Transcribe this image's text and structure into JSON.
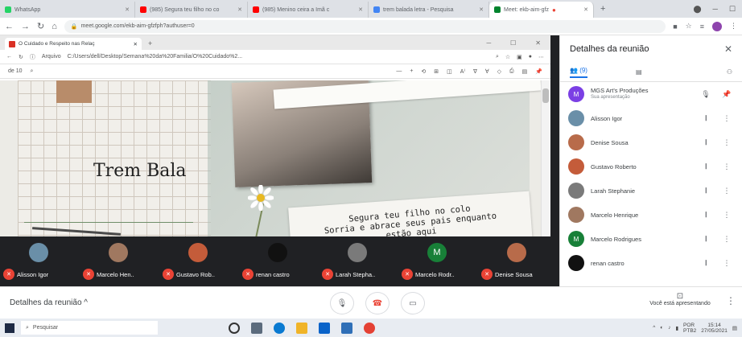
{
  "browser": {
    "tabs": [
      {
        "title": "WhatsApp",
        "color": "#25d366"
      },
      {
        "title": "(985) Segura teu filho no co",
        "color": "#ff0000"
      },
      {
        "title": "(985) Menino ceira a Imã c",
        "color": "#ff0000"
      },
      {
        "title": "trem balada letra - Pesquisa",
        "color": "#4285f4"
      },
      {
        "title": "Meet: ekb-aim-gfz",
        "color": "#00832d",
        "active": true
      }
    ],
    "new_tab": "+",
    "url": "meet.google.com/ekb-aim-gfzfph?authuser=0"
  },
  "inner_window": {
    "tab_title": "O Cuidado e Respeito nas Relaç",
    "file_label": "Arquivo",
    "path": "C:/Users/dell/Desktop/Semana%20da%20Familia/O%20Cuidado%2...",
    "page_indicator": "de 10",
    "zoom_minus": "—",
    "zoom_plus": "+"
  },
  "slide": {
    "title": "Trem Bala",
    "lines": [
      "Segura teu filho no colo",
      "Sorria e abrace seus pais enquanto",
      "estão aqui"
    ]
  },
  "participants_strip": [
    {
      "name": "Alisson Igor",
      "color": "#6a8fa8"
    },
    {
      "name": "Marcelo Hen..",
      "color": "#a07860"
    },
    {
      "name": "Gustavo Rob..",
      "color": "#c45c3a"
    },
    {
      "name": "renan castro",
      "color": "#111111"
    },
    {
      "name": "Larah Stepha..",
      "color": "#7a7a7a"
    },
    {
      "name": "Marcelo Rodr..",
      "color": "#188038",
      "initial": "M"
    },
    {
      "name": "Denise Sousa",
      "color": "#b86b4a"
    }
  ],
  "panel": {
    "title": "Detalhes da reunião",
    "people_tab": "(9)",
    "people": [
      {
        "name": "MGS Art's Produções",
        "sub": "Sua apresentação",
        "color": "#7b3fe4",
        "initial": "M"
      },
      {
        "name": "Alisson Igor",
        "color": "#6a8fa8"
      },
      {
        "name": "Denise Sousa",
        "color": "#b86b4a"
      },
      {
        "name": "Gustavo Roberto",
        "color": "#c45c3a"
      },
      {
        "name": "Larah Stephanie",
        "color": "#7a7a7a"
      },
      {
        "name": "Marcelo Henrique",
        "color": "#a07860"
      },
      {
        "name": "Marcelo Rodrigues",
        "color": "#188038",
        "initial": "M"
      },
      {
        "name": "renan castro",
        "color": "#111111"
      }
    ]
  },
  "meetbar": {
    "details": "Detalhes da reunião",
    "presenting": "Você está apresentando"
  },
  "taskbar": {
    "search_placeholder": "Pesquisar",
    "lang": "POR",
    "lang2": "PTB2",
    "time": "15:14",
    "date": "27/05/2021"
  }
}
